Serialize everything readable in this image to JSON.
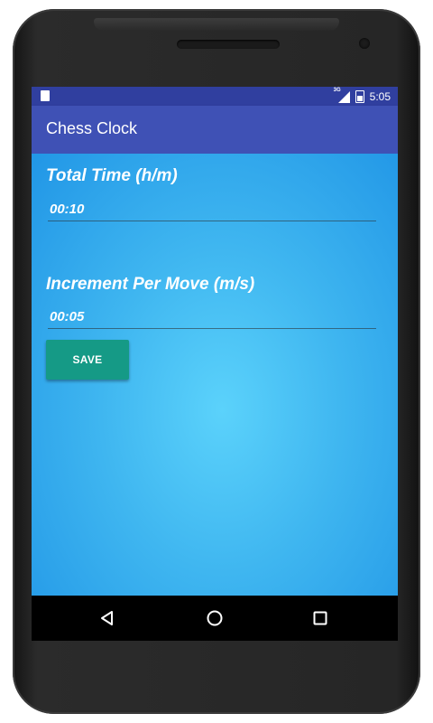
{
  "status_bar": {
    "network_tag": "3G",
    "time": "5:05"
  },
  "app_bar": {
    "title": "Chess Clock"
  },
  "form": {
    "total_time": {
      "label": "Total Time (h/m)",
      "value": "00:10"
    },
    "increment": {
      "label": "Increment Per Move (m/s)",
      "value": "00:05"
    },
    "save_label": "SAVE"
  },
  "nav_bar": {
    "icons": [
      "back-icon",
      "home-icon",
      "recents-icon"
    ]
  },
  "colors": {
    "status_bar": "#303f9f",
    "app_bar": "#3f51b5",
    "content_bg": "#3fb6f0",
    "save_button": "#159a86"
  }
}
